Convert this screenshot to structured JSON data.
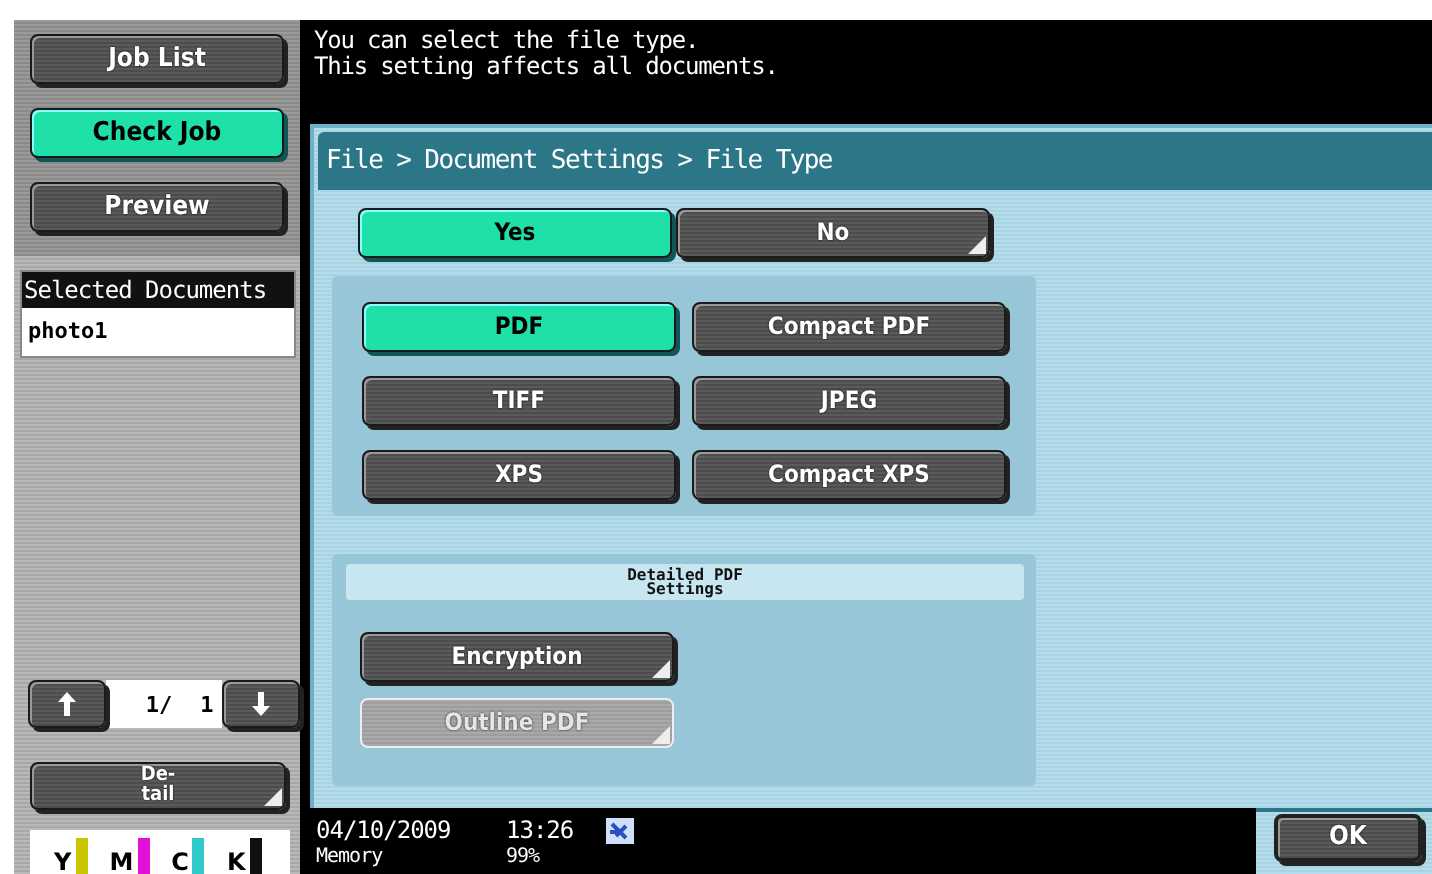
{
  "sidebar": {
    "nav_buttons": [
      {
        "label": "Job List",
        "selected": false
      },
      {
        "label": "Check Job",
        "selected": true
      },
      {
        "label": "Preview",
        "selected": false
      }
    ],
    "selected_documents": {
      "header": "Selected Documents",
      "items": [
        {
          "name": "photo1"
        }
      ]
    },
    "pager": {
      "current": "1/",
      "total": "1"
    },
    "detail_button": {
      "label_lines": [
        "De-",
        "tail"
      ],
      "submenu": true
    },
    "toners": [
      {
        "label": "Y",
        "color": "#c8c400"
      },
      {
        "label": "M",
        "color": "#e010d8"
      },
      {
        "label": "C",
        "color": "#30c8c8"
      },
      {
        "label": "K",
        "color": "#101010"
      }
    ]
  },
  "message": [
    "You can select the file type.",
    "This setting affects all documents."
  ],
  "breadcrumb": "File > Document Settings > File Type",
  "toggle": [
    {
      "label": "Yes",
      "selected": true,
      "submenu": false
    },
    {
      "label": "No",
      "selected": false,
      "submenu": true
    }
  ],
  "file_types": [
    {
      "label": "PDF",
      "selected": true
    },
    {
      "label": "Compact PDF",
      "selected": false
    },
    {
      "label": "TIFF",
      "selected": false
    },
    {
      "label": "JPEG",
      "selected": false
    },
    {
      "label": "XPS",
      "selected": false
    },
    {
      "label": "Compact XPS",
      "selected": false
    }
  ],
  "detailed": {
    "title": "Detailed PDF Settings",
    "buttons": [
      {
        "label": "Encryption",
        "disabled": false,
        "submenu": true
      },
      {
        "label": "Outline PDF",
        "disabled": true,
        "submenu": true
      }
    ]
  },
  "status_bar": {
    "date": "04/10/2009",
    "time": "13:26",
    "memory_label": "Memory",
    "memory_value": "99%"
  },
  "ok_button": "OK"
}
